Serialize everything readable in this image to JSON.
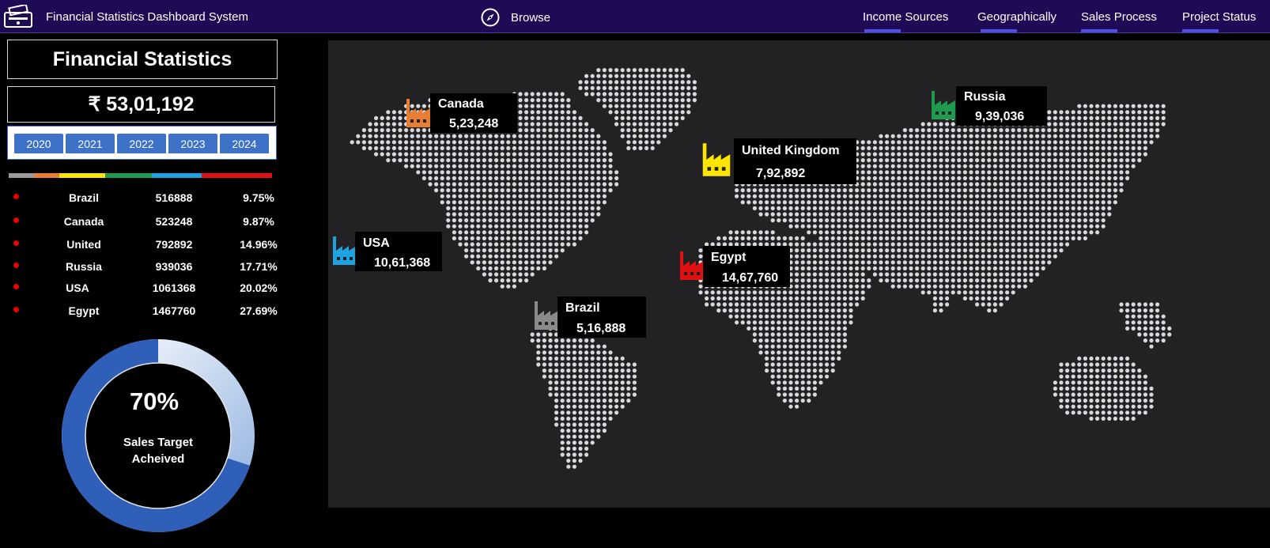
{
  "header": {
    "app_title": "Financial Statistics Dashboard System",
    "browse_label": "Browse",
    "nav": [
      "Income Sources",
      "Geographically",
      "Sales Process",
      "Project Status"
    ]
  },
  "sidebar": {
    "title": "Financial Statistics",
    "total": "₹ 53,01,192",
    "years": [
      "2020",
      "2021",
      "2022",
      "2023",
      "2024"
    ],
    "color_bar": [
      "#9a9a9a",
      "#e87e33",
      "#ffe600",
      "#1f9b4f",
      "#1ea2e0",
      "#e01010"
    ],
    "countries": [
      {
        "name": "Brazil",
        "value": "516888",
        "pct": "9.75%"
      },
      {
        "name": "Canada",
        "value": "523248",
        "pct": "9.87%"
      },
      {
        "name": "United",
        "value": "792892",
        "pct": "14.96%"
      },
      {
        "name": "Russia",
        "value": "939036",
        "pct": "17.71%"
      },
      {
        "name": "USA",
        "value": "1061368",
        "pct": "20.02%"
      },
      {
        "name": "Egypt",
        "value": "1467760",
        "pct": "27.69%"
      }
    ],
    "sales_target": {
      "pct": "70%",
      "label_line1": "Sales Target",
      "label_line2": "Acheived",
      "fraction": 0.7
    }
  },
  "map": {
    "labels": [
      {
        "name": "Canada",
        "value": "5,23,248",
        "color": "#e87e33"
      },
      {
        "name": "Russia",
        "value": "9,39,036",
        "color": "#1f9b4f"
      },
      {
        "name": "United Kingdom",
        "value": "7,92,892",
        "color": "#ffe600"
      },
      {
        "name": "USA",
        "value": "10,61,368",
        "color": "#1ea2e0"
      },
      {
        "name": "Egypt",
        "value": "14,67,760",
        "color": "#e01010"
      },
      {
        "name": "Brazil",
        "value": "5,16,888",
        "color": "#8a8a8a"
      }
    ]
  }
}
